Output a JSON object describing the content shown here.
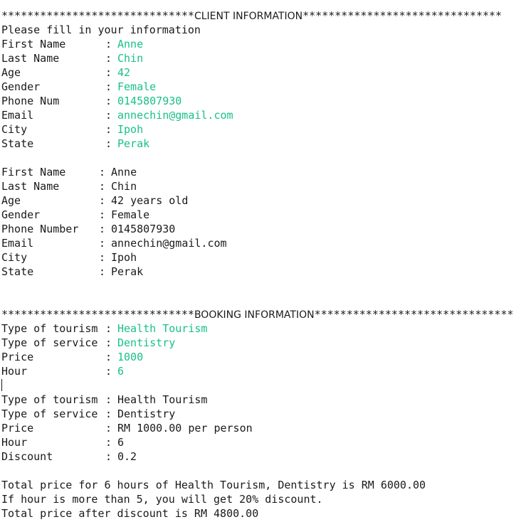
{
  "client_header": {
    "stars_left": "******************************",
    "title": "CLIENT INFORMATION",
    "stars_right": "*******************************"
  },
  "prompt": "Please fill in your information",
  "client_input": [
    {
      "label": "First Name",
      "value": "Anne"
    },
    {
      "label": "Last Name",
      "value": "Chin"
    },
    {
      "label": "Age",
      "value": "42"
    },
    {
      "label": "Gender",
      "value": "Female"
    },
    {
      "label": "Phone Num",
      "value": "0145807930"
    },
    {
      "label": "Email",
      "value": "annechin@gmail.com"
    },
    {
      "label": "City",
      "value": "Ipoh"
    },
    {
      "label": "State",
      "value": "Perak"
    }
  ],
  "client_output": [
    {
      "label": "First Name",
      "value": "Anne"
    },
    {
      "label": "Last Name",
      "value": "Chin"
    },
    {
      "label": "Age",
      "value": "42 years old"
    },
    {
      "label": "Gender",
      "value": "Female"
    },
    {
      "label": "Phone Number",
      "value": "0145807930"
    },
    {
      "label": "Email",
      "value": "annechin@gmail.com"
    },
    {
      "label": "City",
      "value": "Ipoh"
    },
    {
      "label": "State",
      "value": "Perak"
    }
  ],
  "booking_header": {
    "stars_left": "******************************",
    "title": "BOOKING INFORMATION",
    "stars_right": "*******************************"
  },
  "booking_input": [
    {
      "label": "Type of tourism",
      "value": "Health Tourism"
    },
    {
      "label": "Type of service",
      "value": "Dentistry"
    },
    {
      "label": "Price",
      "value": "1000"
    },
    {
      "label": "Hour",
      "value": "6"
    }
  ],
  "booking_output": [
    {
      "label": "Type of tourism",
      "value": "Health Tourism"
    },
    {
      "label": "Type of service",
      "value": "Dentistry"
    },
    {
      "label": "Price",
      "value": "RM 1000.00 per person"
    },
    {
      "label": "Hour",
      "value": "6"
    },
    {
      "label": "Discount",
      "value": "0.2"
    }
  ],
  "separator": ": ",
  "summary": {
    "total": "Total price for 6 hours of Health Tourism, Dentistry is RM 6000.00",
    "discount_note": "If hour is more than 5, you will get 20% discount.",
    "total_after": "Total price after discount is RM 4800.00"
  },
  "colors": {
    "input_text": "#19c08a",
    "output_text": "#1a1a1a",
    "background": "#ffffff"
  }
}
